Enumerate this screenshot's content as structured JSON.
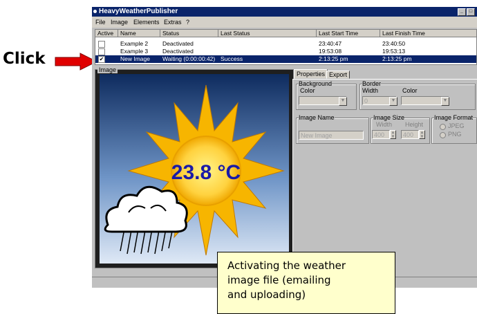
{
  "annotation": {
    "click_label": "Click",
    "callout_lines": [
      "Activating the weather",
      "image file (emailing",
      "and uploading)"
    ],
    "arrow_color": "#e00000"
  },
  "window": {
    "title": "HeavyWeatherPublisher",
    "controls": [
      "_",
      "□"
    ]
  },
  "menu": [
    "File",
    "Image",
    "Elements",
    "Extras",
    "?"
  ],
  "list": {
    "columns": [
      "Active",
      "Name",
      "Status",
      "Last Status",
      "Last Start Time",
      "Last Finish Time"
    ],
    "rows": [
      {
        "active": false,
        "name": "Example 2",
        "status": "Deactivated",
        "last_status": "",
        "last_start": "23:40:47",
        "last_finish": "23:40:50",
        "selected": false
      },
      {
        "active": false,
        "name": "Example 3",
        "status": "Deactivated",
        "last_status": "",
        "last_start": "19:53:08",
        "last_finish": "19:53:13",
        "selected": false
      },
      {
        "active": true,
        "name": "New Image",
        "status": "Waiting (0:00:00:42)",
        "last_status": "Success",
        "last_start": "2:13:25 pm",
        "last_finish": "2:13:25 pm",
        "selected": true
      }
    ]
  },
  "image_panel": {
    "label": "Image",
    "temperature": "23.8 °C"
  },
  "tabs": [
    "Properties",
    "Export"
  ],
  "properties": {
    "background_group": "Background",
    "background_color_label": "Color",
    "border_group": "Border",
    "border_width_label": "Width",
    "border_width_value": "0",
    "border_color_label": "Color",
    "image_name_group": "Image Name",
    "image_name_value": "New Image",
    "image_size_group": "Image Size",
    "width_label": "Width",
    "width_value": "400",
    "height_label": "Height",
    "height_value": "400",
    "image_format_group": "Image Format",
    "format_jpeg": "JPEG",
    "format_png": "PNG"
  }
}
